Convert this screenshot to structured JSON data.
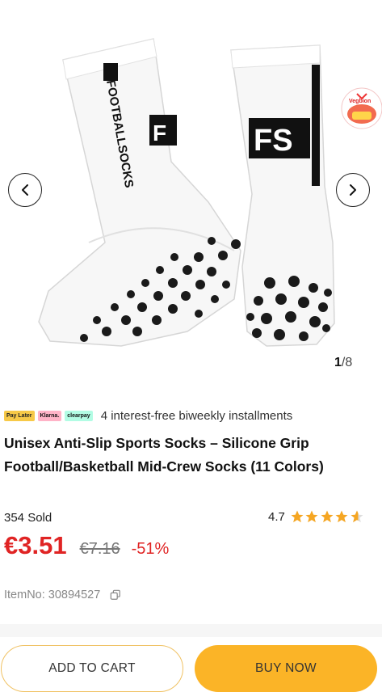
{
  "gallery": {
    "current": "1",
    "total": "/8",
    "sock_left_text": "FOOTBALLSOCKS",
    "sock_right_text": "FS",
    "promo_text": "Vegbion"
  },
  "payment": {
    "badges": [
      "Pay Later",
      "Klarna.",
      "clearpay"
    ],
    "text": "4 interest-free biweekly installments"
  },
  "product": {
    "title": "Unisex Anti-Slip Sports Socks – Silicone Grip Football/Basketball Mid-Crew Socks (11 Colors)",
    "sold": "354 Sold",
    "rating": "4.7",
    "rating_value": 4.7,
    "price": "€3.51",
    "original_price": "€7.16",
    "discount": "-51%",
    "item_no": "ItemNo: 30894527"
  },
  "actions": {
    "add_to_cart": "ADD TO CART",
    "buy_now": "BUY NOW"
  },
  "colors": {
    "price": "#e02424",
    "star": "#f5a623",
    "buy_button": "#fbb427",
    "cart_border": "#f0c264"
  }
}
